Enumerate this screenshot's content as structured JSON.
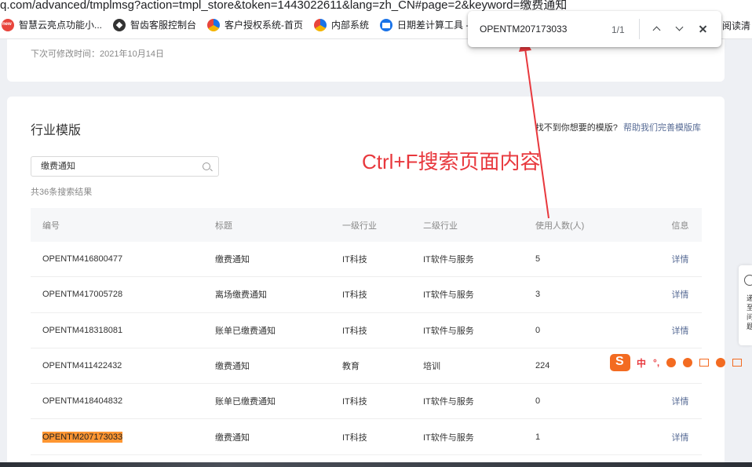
{
  "browser": {
    "url_fragment": "q.com/advanced/tmplmsg?action=tmpl_store&token=1443022611&lang=zh_CN#page=2&keyword=缴费通知",
    "bookmarks": [
      {
        "label": "智慧云亮点功能小...",
        "icon": "new-badge-icon"
      },
      {
        "label": "智齿客服控制台",
        "icon": "compass-icon"
      },
      {
        "label": "客户授权系统-首页",
        "icon": "swirl-icon"
      },
      {
        "label": "内部系统",
        "icon": "swirl-icon"
      },
      {
        "label": "日期差计算工具 -...",
        "icon": "calculator-icon"
      }
    ],
    "reading_list": "阅读清"
  },
  "find_bar": {
    "query": "OPENTM207173033",
    "count": "1/1"
  },
  "top_card": {
    "note": "下次可修改时间：2021年10月14日"
  },
  "templates": {
    "title": "行业模版",
    "help_prompt": "找不到你想要的模版?",
    "help_link": "帮助我们完善模版库",
    "search_value": "缴费通知",
    "result_count": "共36条搜索结果",
    "columns": [
      "编号",
      "标题",
      "一级行业",
      "二级行业",
      "使用人数(人)",
      "信息"
    ],
    "rows": [
      {
        "id": "OPENTM416800477",
        "title": "缴费通知",
        "industry1": "IT科技",
        "industry2": "IT软件与服务",
        "users": "5",
        "info": "详情"
      },
      {
        "id": "OPENTM417005728",
        "title": "离场缴费通知",
        "industry1": "IT科技",
        "industry2": "IT软件与服务",
        "users": "3",
        "info": "详情"
      },
      {
        "id": "OPENTM418318081",
        "title": "账单已缴费通知",
        "industry1": "IT科技",
        "industry2": "IT软件与服务",
        "users": "0",
        "info": "详情"
      },
      {
        "id": "OPENTM411422432",
        "title": "缴费通知",
        "industry1": "教育",
        "industry2": "培训",
        "users": "224",
        "info": ""
      },
      {
        "id": "OPENTM418404832",
        "title": "账单已缴费通知",
        "industry1": "IT科技",
        "industry2": "IT软件与服务",
        "users": "0",
        "info": "详情"
      },
      {
        "id": "OPENTM207173033",
        "title": "缴费通知",
        "industry1": "IT科技",
        "industry2": "IT软件与服务",
        "users": "1",
        "info": "详情"
      }
    ]
  },
  "annotation": {
    "text": "Ctrl+F搜索页面内容",
    "color": "#e8383d"
  },
  "side_widget": {
    "lines": [
      "递",
      "至",
      "问",
      "题"
    ]
  },
  "ime_toolbar": {
    "mode": "中",
    "punct": "°,"
  }
}
